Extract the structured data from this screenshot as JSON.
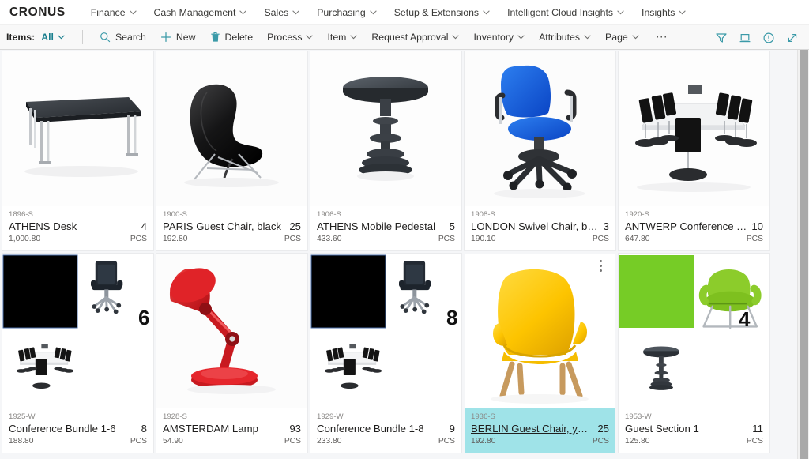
{
  "header": {
    "brand": "CRONUS",
    "nav": [
      {
        "label": "Finance",
        "caret": true
      },
      {
        "label": "Cash Management",
        "caret": true
      },
      {
        "label": "Sales",
        "caret": true
      },
      {
        "label": "Purchasing",
        "caret": true
      },
      {
        "label": "Setup & Extensions",
        "caret": true
      },
      {
        "label": "Intelligent Cloud Insights",
        "caret": true
      },
      {
        "label": "Insights",
        "caret": true
      }
    ]
  },
  "commandbar": {
    "items_label": "Items:",
    "view_label": "All",
    "actions": [
      {
        "label": "Search",
        "icon": "search-icon",
        "caret": false
      },
      {
        "label": "New",
        "icon": "plus-icon",
        "caret": false
      },
      {
        "label": "Delete",
        "icon": "trash-icon",
        "caret": false
      },
      {
        "label": "Process",
        "icon": "",
        "caret": true
      },
      {
        "label": "Item",
        "icon": "",
        "caret": true
      },
      {
        "label": "Request Approval",
        "icon": "",
        "caret": true
      },
      {
        "label": "Inventory",
        "icon": "",
        "caret": true
      },
      {
        "label": "Attributes",
        "icon": "",
        "caret": true
      },
      {
        "label": "Page",
        "icon": "",
        "caret": true
      }
    ],
    "overflow_label": "⋯",
    "right_icons": [
      {
        "name": "filter-icon"
      },
      {
        "name": "focus-mode-icon"
      },
      {
        "name": "info-icon"
      },
      {
        "name": "expand-icon"
      }
    ],
    "accent_color": "#3b9aa8"
  },
  "gallery": {
    "selected_highlight_color": "#9fe3e8",
    "cards": [
      {
        "no": "1896-S",
        "name": "ATHENS Desk",
        "qty": "4",
        "price": "1,000.80",
        "uom": "PCS",
        "art": "desk",
        "selected": false,
        "menu": false
      },
      {
        "no": "1900-S",
        "name": "PARIS Guest Chair, black",
        "qty": "25",
        "price": "192.80",
        "uom": "PCS",
        "art": "paris-chair",
        "selected": false,
        "menu": false
      },
      {
        "no": "1906-S",
        "name": "ATHENS Mobile Pedestal",
        "qty": "5",
        "price": "433.60",
        "uom": "PCS",
        "art": "pedestal",
        "selected": false,
        "menu": false
      },
      {
        "no": "1908-S",
        "name": "LONDON Swivel Chair, blue",
        "qty": "3",
        "price": "190.10",
        "uom": "PCS",
        "art": "blue-swivel",
        "selected": false,
        "menu": false
      },
      {
        "no": "1920-S",
        "name": "ANTWERP Conference Table",
        "qty": "10",
        "price": "647.80",
        "uom": "PCS",
        "art": "conference-table",
        "selected": false,
        "menu": false
      },
      {
        "no": "1925-W",
        "name": "Conference Bundle 1-6",
        "qty": "8",
        "price": "188.80",
        "uom": "PCS",
        "art": "bundle",
        "bundle_num": "6",
        "selected": false,
        "menu": false
      },
      {
        "no": "1928-S",
        "name": "AMSTERDAM Lamp",
        "qty": "93",
        "price": "54.90",
        "uom": "PCS",
        "art": "lamp",
        "selected": false,
        "menu": false
      },
      {
        "no": "1929-W",
        "name": "Conference Bundle 1-8",
        "qty": "9",
        "price": "233.80",
        "uom": "PCS",
        "art": "bundle",
        "bundle_num": "8",
        "selected": false,
        "menu": false
      },
      {
        "no": "1936-S",
        "name": "BERLIN Guest Chair, yellow",
        "qty": "25",
        "price": "192.80",
        "uom": "PCS",
        "art": "yellow-chair",
        "selected": true,
        "menu": true
      },
      {
        "no": "1953-W",
        "name": "Guest Section 1",
        "qty": "11",
        "price": "125.80",
        "uom": "PCS",
        "art": "guest-section",
        "bundle_num": "4",
        "selected": false,
        "menu": false
      }
    ]
  }
}
